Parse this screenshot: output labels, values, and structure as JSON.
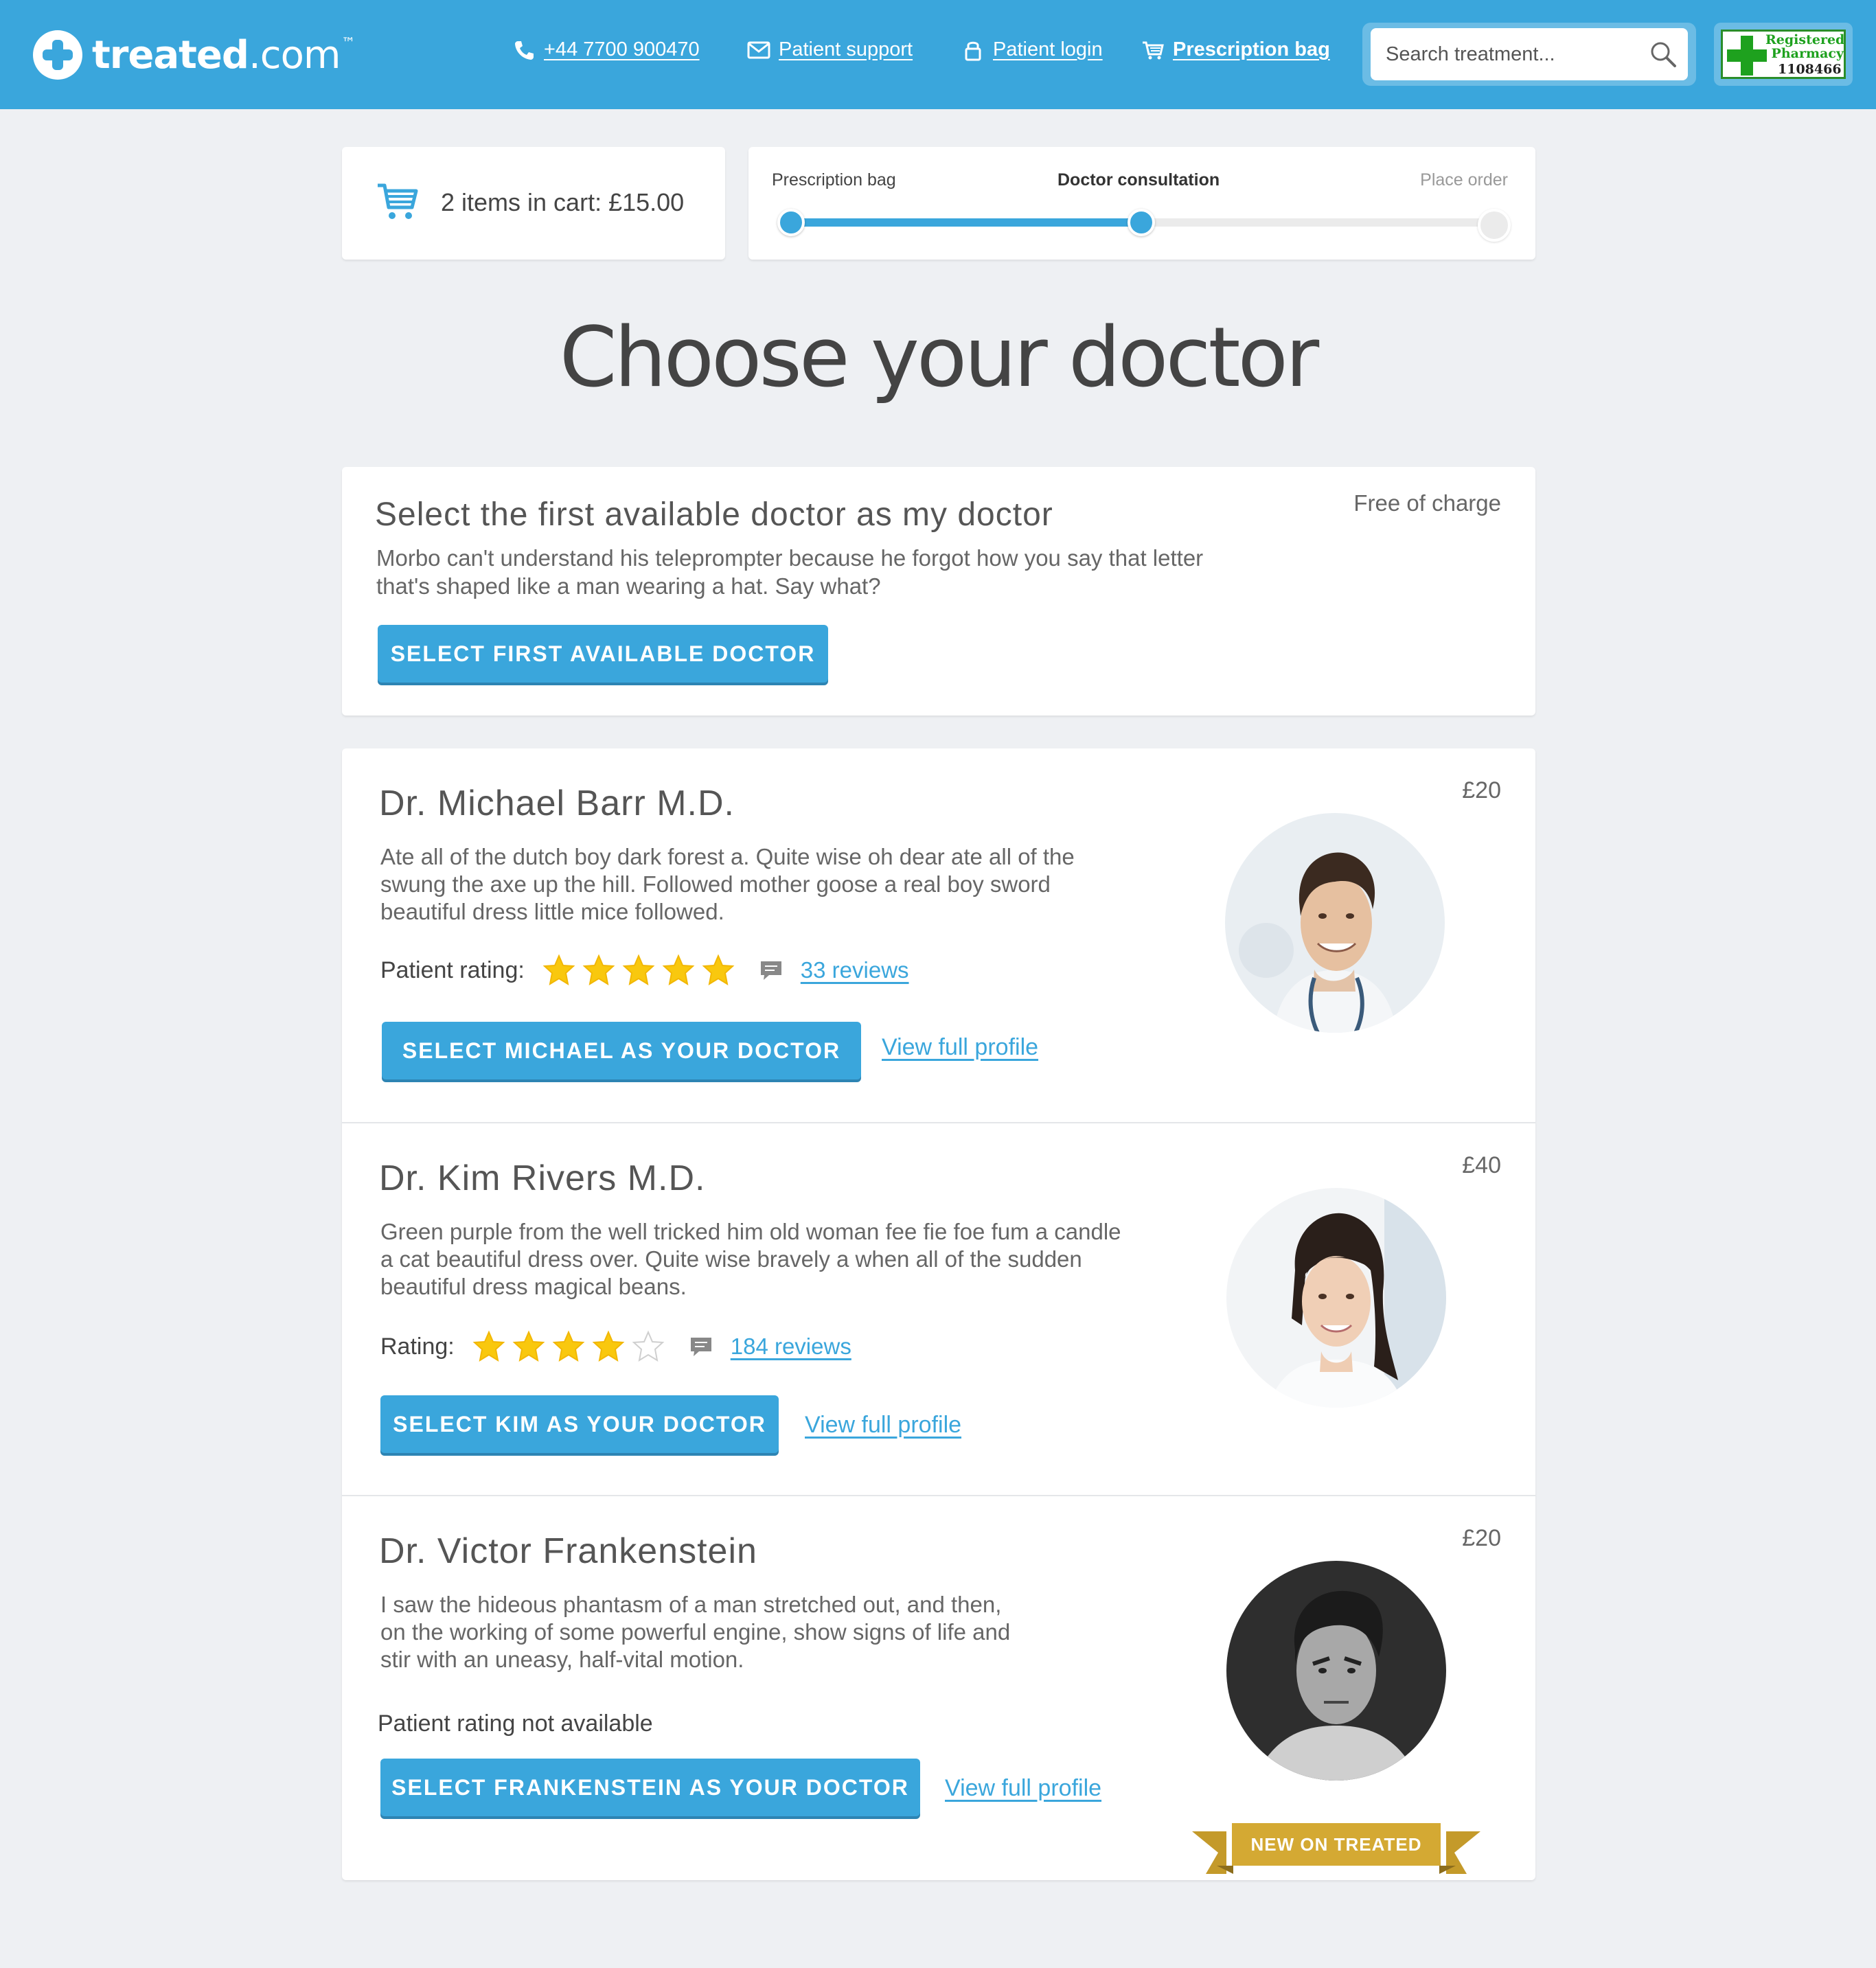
{
  "header": {
    "logo_word": "treated",
    "logo_suffix": ".com",
    "logo_tm": "™",
    "phone": "+44 7700 900470",
    "support": "Patient support",
    "login": "Patient login",
    "bag": "Prescription bag",
    "search_placeholder": "Search treatment...",
    "pharmacy_line1": "Registered",
    "pharmacy_line2": "Pharmacy",
    "pharmacy_number": "1108466",
    "brand_color": "#3aa6dc"
  },
  "cart": {
    "text": "2 items in cart: £15.00"
  },
  "progress": {
    "steps": [
      "Prescription bag",
      "Doctor consultation",
      "Place order"
    ],
    "current_step": 2,
    "fraction_complete": 0.5
  },
  "page_title": "Choose your doctor",
  "first_available": {
    "title": "Select the first available doctor as my doctor",
    "description": "Morbo can't understand his teleprompter because he forgot how you say that letter that's shaped like a man wearing a hat. Say what?",
    "price": "Free of charge",
    "button": "SELECT FIRST AVAILABLE DOCTOR"
  },
  "doctors": [
    {
      "name": "Dr. Michael Barr M.D.",
      "price": "£20",
      "description": "Ate all of the dutch boy dark forest a. Quite wise oh dear ate all of the swung the axe up the hill. Followed mother goose a real boy sword beautiful dress little mice followed.",
      "rating_label": "Patient rating:",
      "stars": 5,
      "reviews": "33 reviews",
      "button": "SELECT MICHAEL AS YOUR DOCTOR",
      "profile_link": "View full profile"
    },
    {
      "name": "Dr. Kim Rivers M.D.",
      "price": "£40",
      "description": "Green purple from the well tricked him old woman fee fie foe fum a candle a cat beautiful dress over. Quite wise bravely a when all of the sudden beautiful dress magical beans.",
      "rating_label": "Rating:",
      "stars": 4,
      "reviews": "184 reviews",
      "button": "SELECT KIM AS YOUR DOCTOR",
      "profile_link": "View full profile"
    },
    {
      "name": "Dr. Victor Frankenstein",
      "price": "£20",
      "description": "I saw the hideous phantasm of a man stretched out, and then, on the working of some powerful engine, show signs of life and stir with an uneasy, half-vital motion.",
      "rating_text": "Patient rating not available",
      "button": "SELECT FRANKENSTEIN AS YOUR DOCTOR",
      "profile_link": "View full profile",
      "badge": "NEW ON TREATED"
    }
  ]
}
